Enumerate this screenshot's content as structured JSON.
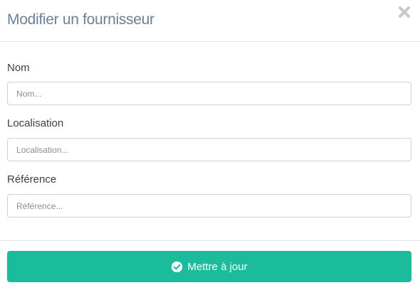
{
  "modal": {
    "title": "Modifier un fournisseur",
    "close_icon": "close-icon"
  },
  "form": {
    "fields": [
      {
        "label": "Nom",
        "placeholder": "Nom...",
        "value": ""
      },
      {
        "label": "Localisation",
        "placeholder": "Localisation...",
        "value": ""
      },
      {
        "label": "Référence",
        "placeholder": "Référence...",
        "value": ""
      }
    ]
  },
  "footer": {
    "submit_label": "Mettre à jour",
    "submit_icon": "check-circle-icon",
    "submit_color": "#1abc9c"
  },
  "colors": {
    "title": "#6b7f95",
    "border": "#cdd2d6"
  }
}
